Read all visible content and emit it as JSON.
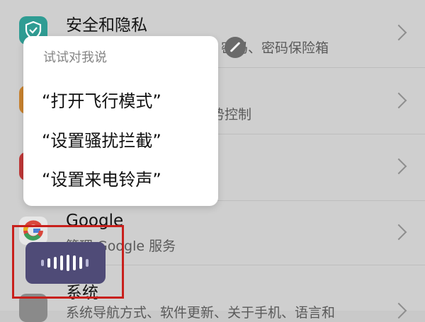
{
  "settings": {
    "items": [
      {
        "title": "安全和隐私",
        "subtitle": "密码、密码保险箱",
        "icon": "shield-icon"
      },
      {
        "title": "",
        "subtitle": "势控制",
        "icon": "app-icon"
      },
      {
        "title": "",
        "subtitle": "",
        "icon": "app-icon"
      },
      {
        "title": "Google",
        "subtitle": "管理 Google 服务",
        "icon": "google-icon"
      },
      {
        "title": "系统",
        "subtitle": "系统导航方式、软件更新、关于手机、语言和",
        "icon": "system-icon"
      }
    ]
  },
  "voice_popup": {
    "heading": "试试对我说",
    "commands": [
      "“打开飞行模式”",
      "“设置骚扰拦截”",
      "“设置来电铃声”"
    ]
  },
  "voice_button": {
    "icon": "voice-wave-icon"
  },
  "colors": {
    "accent": "#2f9c93",
    "highlight": "#c8201c",
    "voice_button": "#4f4b77"
  }
}
